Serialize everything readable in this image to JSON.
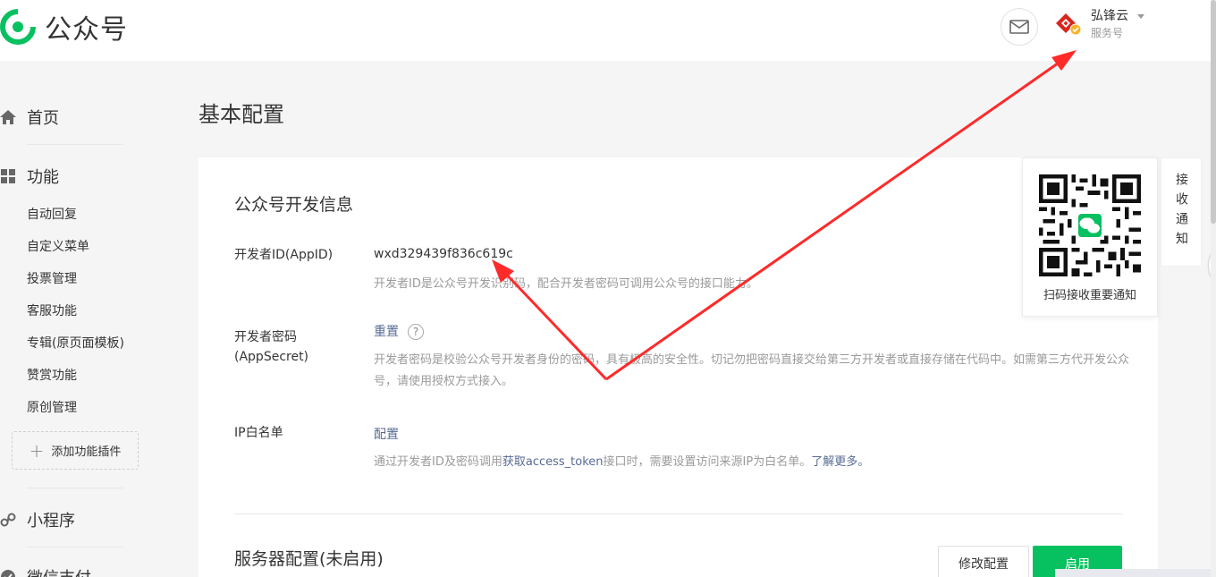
{
  "header": {
    "logo_text": "公众号",
    "account_name": "弘锋云",
    "account_type": "服务号"
  },
  "sidebar": {
    "home": "首页",
    "features": "功能",
    "items": [
      "自动回复",
      "自定义菜单",
      "投票管理",
      "客服功能",
      "专辑(原页面模板)",
      "赞赏功能",
      "原创管理"
    ],
    "add_plugin": "添加功能插件",
    "mini_program": "小程序",
    "wechat_pay": "微信支付"
  },
  "page": {
    "title": "基本配置"
  },
  "dev_info": {
    "section_title": "公众号开发信息",
    "appid_label": "开发者ID(AppID)",
    "appid_value": "wxd329439f836c619c",
    "appid_desc": "开发者ID是公众号开发识别码，配合开发者密码可调用公众号的接口能力。",
    "secret_label": "开发者密码(AppSecret)",
    "secret_reset": "重置",
    "secret_help": "?",
    "secret_desc": "开发者密码是校验公众号开发者身份的密码，具有极高的安全性。切记勿把密码直接交给第三方开发者或直接存储在代码中。如需第三方代开发公众号，请使用授权方式接入。",
    "ip_label": "IP白名单",
    "ip_config": "配置",
    "ip_desc_pre": "通过开发者ID及密码调用",
    "ip_desc_link": "获取access_token",
    "ip_desc_mid": "接口时，需要设置访问来源IP为白名单。",
    "ip_desc_more": "了解更多。"
  },
  "server_config": {
    "title": "服务器配置(未启用)",
    "modify_button": "修改配置",
    "enable_button": "启用"
  },
  "qr_panel": {
    "caption": "扫码接收重要通知",
    "tab": "接收通知"
  },
  "colors": {
    "brand_green": "#07c160",
    "link": "#576b95",
    "annotation_red": "#ff2a2a"
  }
}
